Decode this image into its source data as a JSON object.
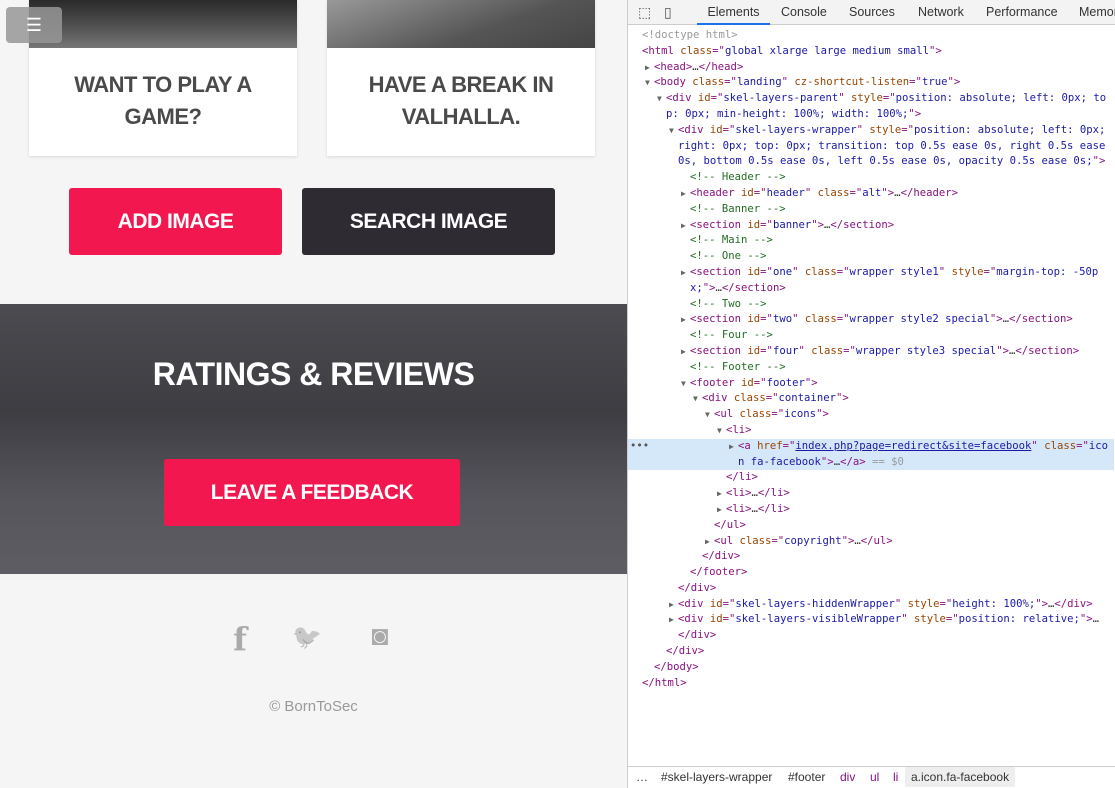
{
  "page": {
    "menu_icon": "hamburger-icon",
    "cards": [
      {
        "title": "WANT TO PLAY A GAME?"
      },
      {
        "title": "HAVE A BREAK IN VALHALLA."
      }
    ],
    "add_image": "ADD IMAGE",
    "search_image": "SEARCH IMAGE",
    "banner_title": "RATINGS & REVIEWS",
    "feedback": "LEAVE A FEEDBACK",
    "social": [
      {
        "icon": "facebook-icon",
        "glyph": "f"
      },
      {
        "icon": "twitter-icon",
        "glyph": "🐦"
      },
      {
        "icon": "instagram-icon",
        "glyph": "◙"
      }
    ],
    "copyright": "© BornToSec",
    "colors": {
      "accent": "#f2184f",
      "dark_button": "#2e2b33",
      "background": "#f5f5f5"
    }
  },
  "devtools": {
    "tabs": [
      "Elements",
      "Console",
      "Sources",
      "Network",
      "Performance",
      "Memor"
    ],
    "active_tab": "Elements",
    "selected_suffix": "== $0",
    "tree": [
      {
        "d": 0,
        "tok": [
          [
            "g",
            "<!doctype html>"
          ]
        ]
      },
      {
        "d": 0,
        "tok": [
          [
            "t",
            "<html "
          ],
          [
            "a",
            "class"
          ],
          [
            "t",
            "=\""
          ],
          [
            "v",
            "global xlarge large medium small"
          ],
          [
            "t",
            "\">"
          ]
        ]
      },
      {
        "d": 1,
        "arrow": "▶",
        "tok": [
          [
            "t",
            "<head>"
          ],
          [
            "p",
            "…"
          ],
          [
            "t",
            "</head>"
          ]
        ]
      },
      {
        "d": 1,
        "arrow": "▼",
        "tok": [
          [
            "t",
            "<body "
          ],
          [
            "a",
            "class"
          ],
          [
            "t",
            "=\""
          ],
          [
            "v",
            "landing"
          ],
          [
            "t",
            "\" "
          ],
          [
            "a",
            "cz-shortcut-listen"
          ],
          [
            "t",
            "=\""
          ],
          [
            "v",
            "true"
          ],
          [
            "t",
            "\">"
          ]
        ]
      },
      {
        "d": 2,
        "arrow": "▼",
        "tok": [
          [
            "t",
            "<div "
          ],
          [
            "a",
            "id"
          ],
          [
            "t",
            "=\""
          ],
          [
            "v",
            "skel-layers-parent"
          ],
          [
            "t",
            "\" "
          ],
          [
            "a",
            "style"
          ],
          [
            "t",
            "=\""
          ],
          [
            "v",
            "position: absolute; left: 0px; top: 0px; min-height: 100%; width: 100%;"
          ],
          [
            "t",
            "\">"
          ]
        ]
      },
      {
        "d": 3,
        "arrow": "▼",
        "tok": [
          [
            "t",
            "<div "
          ],
          [
            "a",
            "id"
          ],
          [
            "t",
            "=\""
          ],
          [
            "v",
            "skel-layers-wrapper"
          ],
          [
            "t",
            "\" "
          ],
          [
            "a",
            "style"
          ],
          [
            "t",
            "=\""
          ],
          [
            "v",
            "position: absolute; left: 0px; right: 0px; top: 0px; transition: top 0.5s ease 0s, right 0.5s ease 0s, bottom 0.5s ease 0s, left 0.5s ease 0s, opacity 0.5s ease 0s;"
          ],
          [
            "t",
            "\">"
          ]
        ]
      },
      {
        "d": 4,
        "tok": [
          [
            "c",
            "<!-- Header -->"
          ]
        ]
      },
      {
        "d": 4,
        "arrow": "▶",
        "tok": [
          [
            "t",
            "<header "
          ],
          [
            "a",
            "id"
          ],
          [
            "t",
            "=\""
          ],
          [
            "v",
            "header"
          ],
          [
            "t",
            "\" "
          ],
          [
            "a",
            "class"
          ],
          [
            "t",
            "=\""
          ],
          [
            "v",
            "alt"
          ],
          [
            "t",
            "\">"
          ],
          [
            "p",
            "…"
          ],
          [
            "t",
            "</header>"
          ]
        ]
      },
      {
        "d": 4,
        "tok": [
          [
            "c",
            "<!-- Banner -->"
          ]
        ]
      },
      {
        "d": 4,
        "arrow": "▶",
        "tok": [
          [
            "t",
            "<section "
          ],
          [
            "a",
            "id"
          ],
          [
            "t",
            "=\""
          ],
          [
            "v",
            "banner"
          ],
          [
            "t",
            "\">"
          ],
          [
            "p",
            "…"
          ],
          [
            "t",
            "</section>"
          ]
        ]
      },
      {
        "d": 4,
        "tok": [
          [
            "c",
            "<!-- Main -->"
          ]
        ]
      },
      {
        "d": 4,
        "tok": [
          [
            "c",
            "<!-- One -->"
          ]
        ]
      },
      {
        "d": 4,
        "arrow": "▶",
        "tok": [
          [
            "t",
            "<section "
          ],
          [
            "a",
            "id"
          ],
          [
            "t",
            "=\""
          ],
          [
            "v",
            "one"
          ],
          [
            "t",
            "\" "
          ],
          [
            "a",
            "class"
          ],
          [
            "t",
            "=\""
          ],
          [
            "v",
            "wrapper style1"
          ],
          [
            "t",
            "\" "
          ],
          [
            "a",
            "style"
          ],
          [
            "t",
            "=\""
          ],
          [
            "v",
            "margin-top: -50px;"
          ],
          [
            "t",
            "\">"
          ],
          [
            "p",
            "…"
          ],
          [
            "t",
            "</section>"
          ]
        ]
      },
      {
        "d": 4,
        "tok": [
          [
            "c",
            "<!-- Two -->"
          ]
        ]
      },
      {
        "d": 4,
        "arrow": "▶",
        "tok": [
          [
            "t",
            "<section "
          ],
          [
            "a",
            "id"
          ],
          [
            "t",
            "=\""
          ],
          [
            "v",
            "two"
          ],
          [
            "t",
            "\" "
          ],
          [
            "a",
            "class"
          ],
          [
            "t",
            "=\""
          ],
          [
            "v",
            "wrapper style2 special"
          ],
          [
            "t",
            "\">"
          ],
          [
            "p",
            "…"
          ],
          [
            "t",
            "</section>"
          ]
        ]
      },
      {
        "d": 4,
        "tok": [
          [
            "c",
            "<!-- Four -->"
          ]
        ]
      },
      {
        "d": 4,
        "arrow": "▶",
        "tok": [
          [
            "t",
            "<section "
          ],
          [
            "a",
            "id"
          ],
          [
            "t",
            "=\""
          ],
          [
            "v",
            "four"
          ],
          [
            "t",
            "\" "
          ],
          [
            "a",
            "class"
          ],
          [
            "t",
            "=\""
          ],
          [
            "v",
            "wrapper style3 special"
          ],
          [
            "t",
            "\">"
          ],
          [
            "p",
            "…"
          ],
          [
            "t",
            "</section>"
          ]
        ]
      },
      {
        "d": 4,
        "tok": [
          [
            "c",
            "<!-- Footer -->"
          ]
        ]
      },
      {
        "d": 4,
        "arrow": "▼",
        "tok": [
          [
            "t",
            "<footer "
          ],
          [
            "a",
            "id"
          ],
          [
            "t",
            "=\""
          ],
          [
            "v",
            "footer"
          ],
          [
            "t",
            "\">"
          ]
        ]
      },
      {
        "d": 5,
        "arrow": "▼",
        "tok": [
          [
            "t",
            "<div "
          ],
          [
            "a",
            "class"
          ],
          [
            "t",
            "=\""
          ],
          [
            "v",
            "container"
          ],
          [
            "t",
            "\">"
          ]
        ]
      },
      {
        "d": 6,
        "arrow": "▼",
        "tok": [
          [
            "t",
            "<ul "
          ],
          [
            "a",
            "class"
          ],
          [
            "t",
            "=\""
          ],
          [
            "v",
            "icons"
          ],
          [
            "t",
            "\">"
          ]
        ]
      },
      {
        "d": 7,
        "arrow": "▼",
        "tok": [
          [
            "t",
            "<li>"
          ]
        ]
      },
      {
        "d": 8,
        "arrow": "▶",
        "sel": true,
        "tok": [
          [
            "t",
            "<a "
          ],
          [
            "a",
            "href"
          ],
          [
            "t",
            "=\""
          ],
          [
            "l",
            "index.php?page=redirect&site=facebook"
          ],
          [
            "t",
            "\" "
          ],
          [
            "a",
            "class"
          ],
          [
            "t",
            "=\""
          ],
          [
            "v",
            "icon fa-facebook"
          ],
          [
            "t",
            "\">"
          ],
          [
            "p",
            "…"
          ],
          [
            "t",
            "</a>"
          ],
          [
            "g",
            " == $0"
          ]
        ]
      },
      {
        "d": 7,
        "tok": [
          [
            "t",
            "</li>"
          ]
        ]
      },
      {
        "d": 7,
        "arrow": "▶",
        "tok": [
          [
            "t",
            "<li>"
          ],
          [
            "p",
            "…"
          ],
          [
            "t",
            "</li>"
          ]
        ]
      },
      {
        "d": 7,
        "arrow": "▶",
        "tok": [
          [
            "t",
            "<li>"
          ],
          [
            "p",
            "…"
          ],
          [
            "t",
            "</li>"
          ]
        ]
      },
      {
        "d": 6,
        "tok": [
          [
            "t",
            "</ul>"
          ]
        ]
      },
      {
        "d": 6,
        "arrow": "▶",
        "tok": [
          [
            "t",
            "<ul "
          ],
          [
            "a",
            "class"
          ],
          [
            "t",
            "=\""
          ],
          [
            "v",
            "copyright"
          ],
          [
            "t",
            "\">"
          ],
          [
            "p",
            "…"
          ],
          [
            "t",
            "</ul>"
          ]
        ]
      },
      {
        "d": 5,
        "tok": [
          [
            "t",
            "</div>"
          ]
        ]
      },
      {
        "d": 4,
        "tok": [
          [
            "t",
            "</footer>"
          ]
        ]
      },
      {
        "d": 3,
        "tok": [
          [
            "t",
            "</div>"
          ]
        ]
      },
      {
        "d": 3,
        "arrow": "▶",
        "tok": [
          [
            "t",
            "<div "
          ],
          [
            "a",
            "id"
          ],
          [
            "t",
            "=\""
          ],
          [
            "v",
            "skel-layers-hiddenWrapper"
          ],
          [
            "t",
            "\" "
          ],
          [
            "a",
            "style"
          ],
          [
            "t",
            "=\""
          ],
          [
            "v",
            "height: 100%;"
          ],
          [
            "t",
            "\">"
          ],
          [
            "p",
            "…"
          ],
          [
            "t",
            "</div>"
          ]
        ]
      },
      {
        "d": 3,
        "arrow": "▶",
        "tok": [
          [
            "t",
            "<div "
          ],
          [
            "a",
            "id"
          ],
          [
            "t",
            "=\""
          ],
          [
            "v",
            "skel-layers-visibleWrapper"
          ],
          [
            "t",
            "\" "
          ],
          [
            "a",
            "style"
          ],
          [
            "t",
            "=\""
          ],
          [
            "v",
            "position: relative;"
          ],
          [
            "t",
            "\">"
          ],
          [
            "p",
            "…"
          ],
          [
            "t",
            "</div>"
          ]
        ]
      },
      {
        "d": 2,
        "tok": [
          [
            "t",
            "</div>"
          ]
        ]
      },
      {
        "d": 1,
        "tok": [
          [
            "t",
            "</body>"
          ]
        ]
      },
      {
        "d": 0,
        "tok": [
          [
            "t",
            "</html>"
          ]
        ]
      }
    ],
    "breadcrumb": [
      "…",
      "#skel-layers-wrapper",
      "#footer",
      "div",
      "ul",
      "li",
      "a.icon.fa-facebook"
    ]
  }
}
